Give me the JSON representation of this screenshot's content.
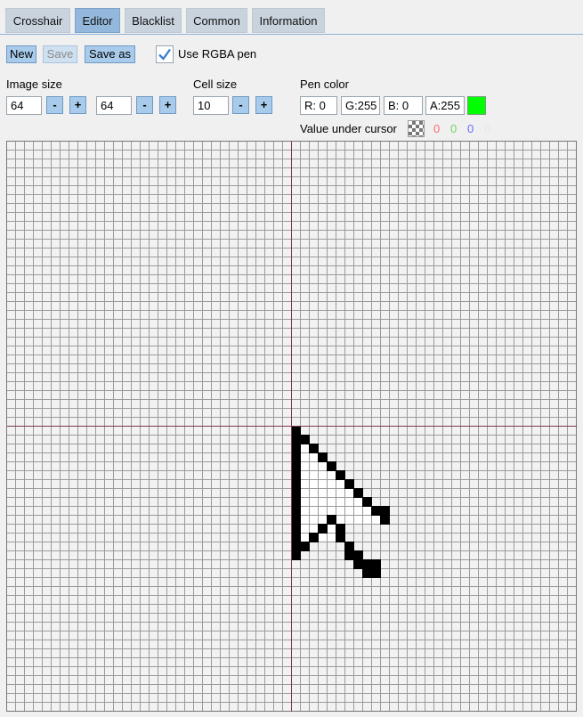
{
  "tabs": [
    "Crosshair",
    "Editor",
    "Blacklist",
    "Common",
    "Information"
  ],
  "toolbar": {
    "new_label": "New",
    "save_label": "Save",
    "save_as_label": "Save as",
    "rgba_label": "Use RGBA pen",
    "rgba_checked": true
  },
  "image_size": {
    "label": "Image size",
    "width": "64",
    "height": "64",
    "minus": "-",
    "plus": "+"
  },
  "cell_size": {
    "label": "Cell size",
    "value": "10",
    "minus": "-",
    "plus": "+"
  },
  "pen_color": {
    "label": "Pen color",
    "r": "R:  0",
    "g": "G:255",
    "b": "B:  0",
    "a": "A:255",
    "swatch": "#00ff00"
  },
  "cursor_value": {
    "label": "Value under cursor",
    "r": "0",
    "g": "0",
    "b": "0",
    "a": "0",
    "r_color": "#ff6b6b",
    "g_color": "#6bd66b",
    "b_color": "#6b6bff",
    "a_color": "#e8e8e8"
  },
  "editor": {
    "grid_cells": 64,
    "crosshair_color": "#7a3a52",
    "sprite": {
      "black": [
        [
          0,
          0
        ],
        [
          0,
          1
        ],
        [
          1,
          1
        ],
        [
          0,
          2
        ],
        [
          2,
          2
        ],
        [
          0,
          3
        ],
        [
          3,
          3
        ],
        [
          0,
          4
        ],
        [
          4,
          4
        ],
        [
          0,
          5
        ],
        [
          5,
          5
        ],
        [
          0,
          6
        ],
        [
          6,
          6
        ],
        [
          0,
          7
        ],
        [
          7,
          7
        ],
        [
          0,
          8
        ],
        [
          8,
          8
        ],
        [
          0,
          9
        ],
        [
          9,
          9
        ],
        [
          10,
          9
        ],
        [
          0,
          10
        ],
        [
          4,
          10
        ],
        [
          10,
          10
        ],
        [
          0,
          11
        ],
        [
          3,
          11
        ],
        [
          5,
          11
        ],
        [
          0,
          12
        ],
        [
          2,
          12
        ],
        [
          5,
          12
        ],
        [
          0,
          13
        ],
        [
          1,
          13
        ],
        [
          6,
          13
        ],
        [
          0,
          14
        ],
        [
          6,
          14
        ],
        [
          7,
          14
        ],
        [
          7,
          15
        ],
        [
          8,
          15
        ],
        [
          9,
          15
        ],
        [
          8,
          16
        ],
        [
          9,
          16
        ]
      ]
    }
  }
}
